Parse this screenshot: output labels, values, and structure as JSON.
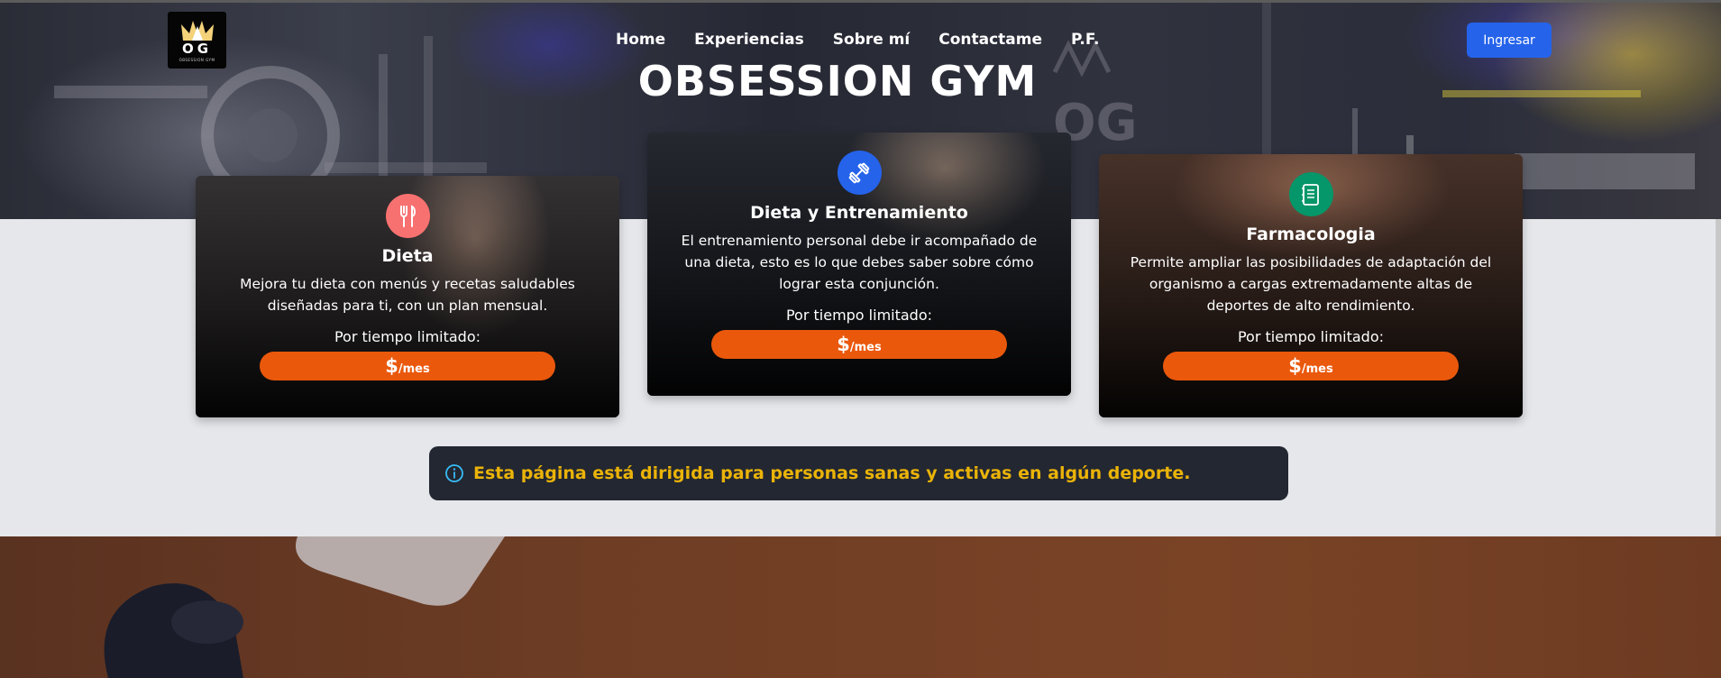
{
  "brand": {
    "logo_text": "OG",
    "logo_sub": "OBSESSION GYM",
    "hero_title": "OBSESSION GYM"
  },
  "nav": {
    "items": [
      "Home",
      "Experiencias",
      "Sobre mí",
      "Contactame",
      "P.F."
    ]
  },
  "header": {
    "login_label": "Ingresar"
  },
  "cards": [
    {
      "title": "Dieta",
      "description": "Mejora tu dieta con menús y recetas saludables diseñadas para ti, con un plan mensual.",
      "limited": "Por tiempo limitado:",
      "currency": "$",
      "period": "/mes",
      "icon": "fork-knife-icon",
      "icon_color": "#f87171"
    },
    {
      "title": "Dieta y Entrenamiento",
      "description": "El entrenamiento personal debe ir acompañado de una dieta, esto es lo que debes saber sobre cómo lograr esta conjunción.",
      "limited": "Por tiempo limitado:",
      "currency": "$",
      "period": "/mes",
      "icon": "dumbbell-icon",
      "icon_color": "#2563eb"
    },
    {
      "title": "Farmacologia",
      "description": "Permite ampliar las posibilidades de adaptación del organismo a cargas extremadamente altas de deportes de alto rendimiento.",
      "limited": "Por tiempo limitado:",
      "currency": "$",
      "period": "/mes",
      "icon": "notebook-icon",
      "icon_color": "#059669"
    }
  ],
  "alert": {
    "icon": "info-icon",
    "text": "Esta página está dirigida para personas sanas y activas en algún deporte."
  },
  "colors": {
    "accent": "#ea580c",
    "primary": "#2563eb",
    "alert_text": "#eab308",
    "alert_bg": "#232731"
  }
}
